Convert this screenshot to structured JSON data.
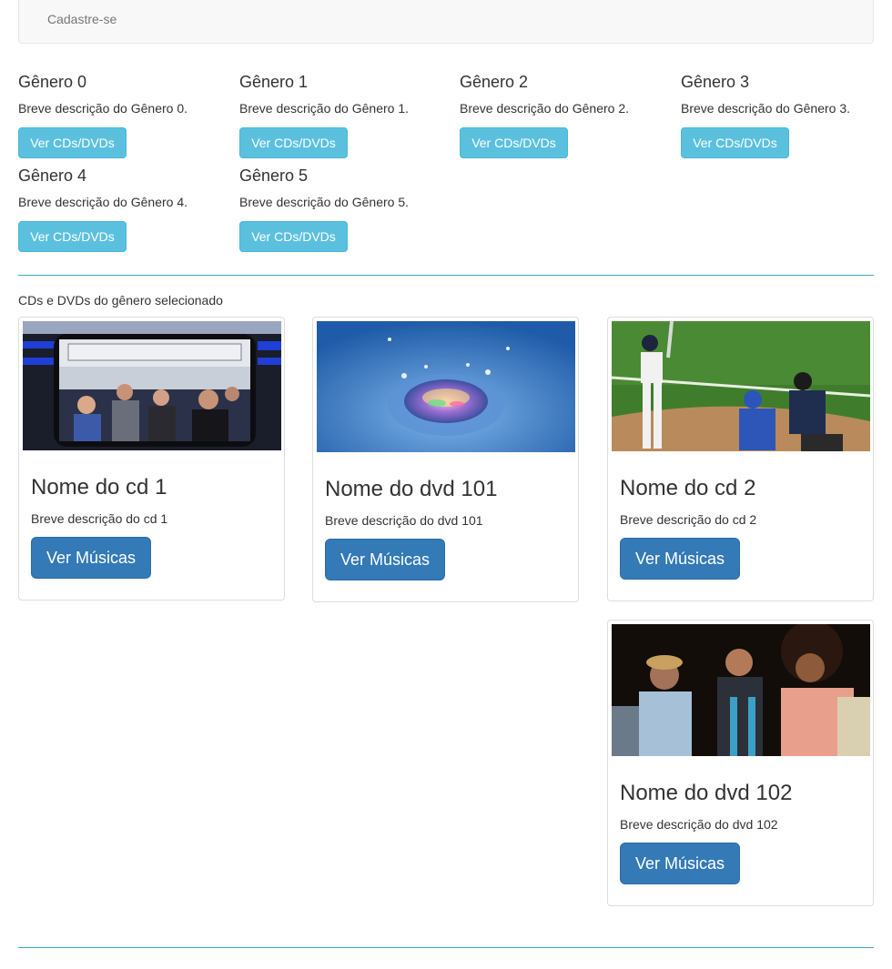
{
  "navbar": {
    "link_label": "Cadastre-se"
  },
  "genres": [
    {
      "title": "Gênero 0",
      "description": "Breve descrição do Gênero 0.",
      "button_label": "Ver CDs/DVDs"
    },
    {
      "title": "Gênero 1",
      "description": "Breve descrição do Gênero 1.",
      "button_label": "Ver CDs/DVDs"
    },
    {
      "title": "Gênero 2",
      "description": "Breve descrição do Gênero 2.",
      "button_label": "Ver CDs/DVDs"
    },
    {
      "title": "Gênero 3",
      "description": "Breve descrição do Gênero 3.",
      "button_label": "Ver CDs/DVDs"
    },
    {
      "title": "Gênero 4",
      "description": "Breve descrição do Gênero 4.",
      "button_label": "Ver CDs/DVDs"
    },
    {
      "title": "Gênero 5",
      "description": "Breve descrição do Gênero 5.",
      "button_label": "Ver CDs/DVDs"
    }
  ],
  "products_section": {
    "title": "CDs e DVDs do gênero selecionado"
  },
  "products": [
    {
      "title": "Nome do cd 1",
      "description": "Breve descrição do cd 1",
      "button_label": "Ver Músicas",
      "image": "subway-window-photo"
    },
    {
      "title": "Nome do dvd 101",
      "description": "Breve descrição do dvd 101",
      "button_label": "Ver Músicas",
      "image": "water-drop-photo"
    },
    {
      "title": "Nome do cd 2",
      "description": "Breve descrição do cd 2",
      "button_label": "Ver Músicas",
      "image": "baseball-photo"
    },
    {
      "title": "Nome do dvd 102",
      "description": "Breve descrição do dvd 102",
      "button_label": "Ver Músicas",
      "image": "dancers-photo"
    }
  ],
  "colors": {
    "info_button": "#5bc0de",
    "primary_button": "#337ab7",
    "divider": "#3ba9b8",
    "navbar_bg": "#f8f8f8"
  }
}
